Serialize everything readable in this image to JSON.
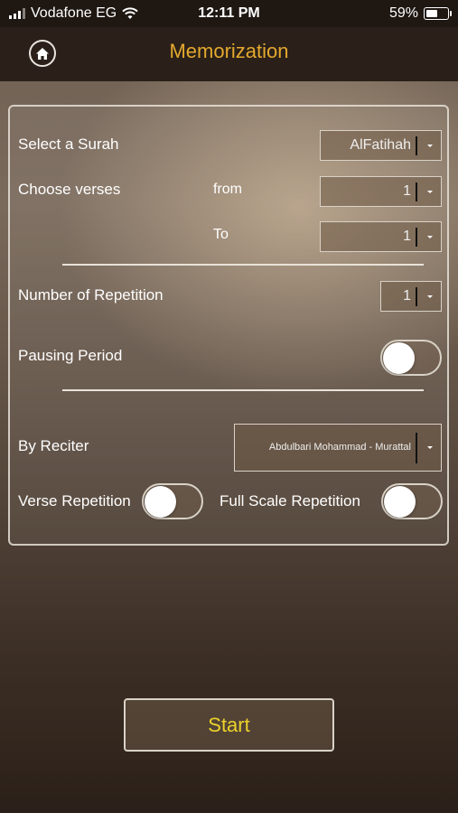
{
  "status_bar": {
    "carrier": "Vodafone EG",
    "time": "12:11 PM",
    "battery": "59%",
    "battery_level": 0.59,
    "icons": [
      "signal-icon",
      "wifi-icon",
      "battery-icon"
    ]
  },
  "header": {
    "title": "Memorization",
    "home_icon": "home-icon"
  },
  "form": {
    "surah": {
      "label": "Select a Surah",
      "value": "AlFatihah"
    },
    "verses": {
      "label": "Choose verses",
      "from_label": "from",
      "from_value": "1",
      "to_label": "To",
      "to_value": "1"
    },
    "repetition": {
      "label": "Number of Repetition",
      "value": "1"
    },
    "pausing": {
      "label": "Pausing Period",
      "enabled": false
    },
    "reciter": {
      "label": "By Reciter",
      "value": "Abdulbari Mohammad - Murattal"
    },
    "verse_repetition": {
      "label": "Verse Repetition",
      "enabled": false
    },
    "full_scale_repetition": {
      "label": "Full Scale Repetition",
      "enabled": false
    }
  },
  "actions": {
    "start_label": "Start"
  },
  "colors": {
    "title": "#e4a92e",
    "start_text": "#ecd22a",
    "bar": "#2a2019"
  }
}
